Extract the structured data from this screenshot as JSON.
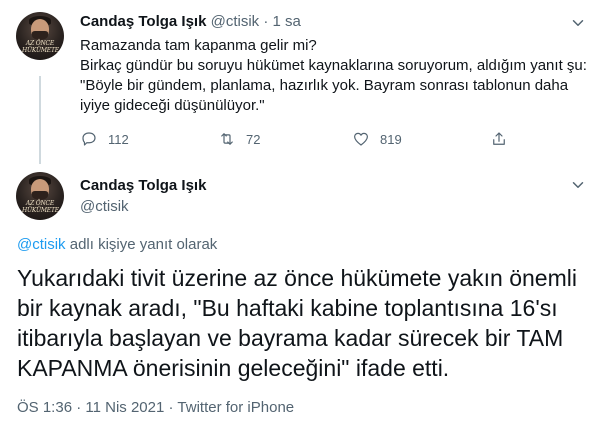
{
  "parent_tweet": {
    "author_name": "Candaş Tolga Işık",
    "handle": "@ctisik",
    "separator": "·",
    "time": "1 sa",
    "lines": [
      "Ramazanda tam kapanma gelir mi?",
      "Birkaç gündür bu soruyu hükümet kaynaklarına soruyorum, aldığım yanıt şu:",
      "\"Böyle bir gündem, planlama, hazırlık yok. Bayram sonrası tablonun daha",
      "iyiye gideceği düşünülüyor.\""
    ],
    "actions": {
      "replies": "112",
      "retweets": "72",
      "likes": "819"
    }
  },
  "avatar_logo": {
    "line1": "AZ ÖNCE",
    "line2": "HÜKÜMETE"
  },
  "main_tweet": {
    "author_name": "Candaş Tolga Işık",
    "handle": "@ctisik",
    "reply_mention": "@ctisik",
    "reply_suffix": " adlı kişiye yanıt olarak",
    "lines": [
      "Yukarıdaki tivit üzerine az önce hükümete yakın önemli",
      "bir kaynak aradı, \"Bu haftaki kabine toplantısına 16'sı",
      "itibarıyla başlayan ve bayrama kadar sürecek bir TAM",
      "KAPANMA önerisinin geleceğini\" ifade etti."
    ],
    "time": "ÖS 1:36",
    "separator": "·",
    "date": "11 Nis 2021",
    "source": "Twitter for iPhone"
  },
  "colors": {
    "text": "#0f1419",
    "muted": "#536471",
    "link": "#1d9bf0",
    "thread_line": "#cfd9de"
  }
}
